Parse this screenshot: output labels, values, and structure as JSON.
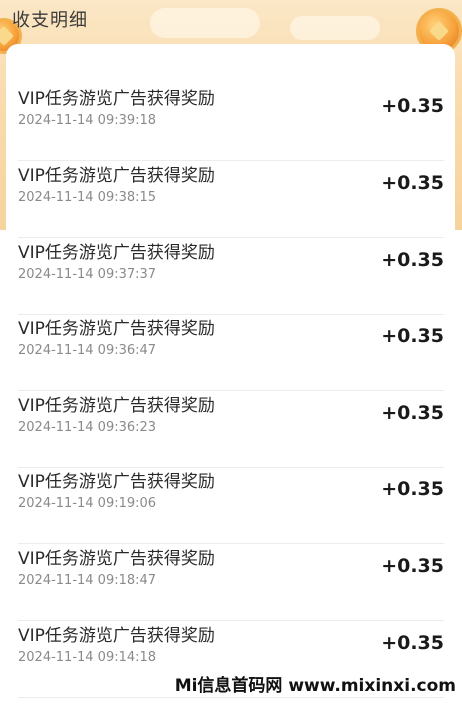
{
  "header": {
    "title": "收支明细"
  },
  "records": [
    {
      "title": "VIP任务游览广告获得奖励",
      "time": "2024-11-14 09:39:18",
      "amount": "+0.35"
    },
    {
      "title": "VIP任务游览广告获得奖励",
      "time": "2024-11-14 09:38:15",
      "amount": "+0.35"
    },
    {
      "title": "VIP任务游览广告获得奖励",
      "time": "2024-11-14 09:37:37",
      "amount": "+0.35"
    },
    {
      "title": "VIP任务游览广告获得奖励",
      "time": "2024-11-14 09:36:47",
      "amount": "+0.35"
    },
    {
      "title": "VIP任务游览广告获得奖励",
      "time": "2024-11-14 09:36:23",
      "amount": "+0.35"
    },
    {
      "title": "VIP任务游览广告获得奖励",
      "time": "2024-11-14 09:19:06",
      "amount": "+0.35"
    },
    {
      "title": "VIP任务游览广告获得奖励",
      "time": "2024-11-14 09:18:47",
      "amount": "+0.35"
    },
    {
      "title": "VIP任务游览广告获得奖励",
      "time": "2024-11-14 09:14:18",
      "amount": "+0.35"
    }
  ],
  "watermark": "Mi信息首码网 www.mixinxi.com",
  "colors": {
    "banner": "#f9dcae",
    "card": "#ffffff",
    "amount": "#1a1a1a"
  }
}
